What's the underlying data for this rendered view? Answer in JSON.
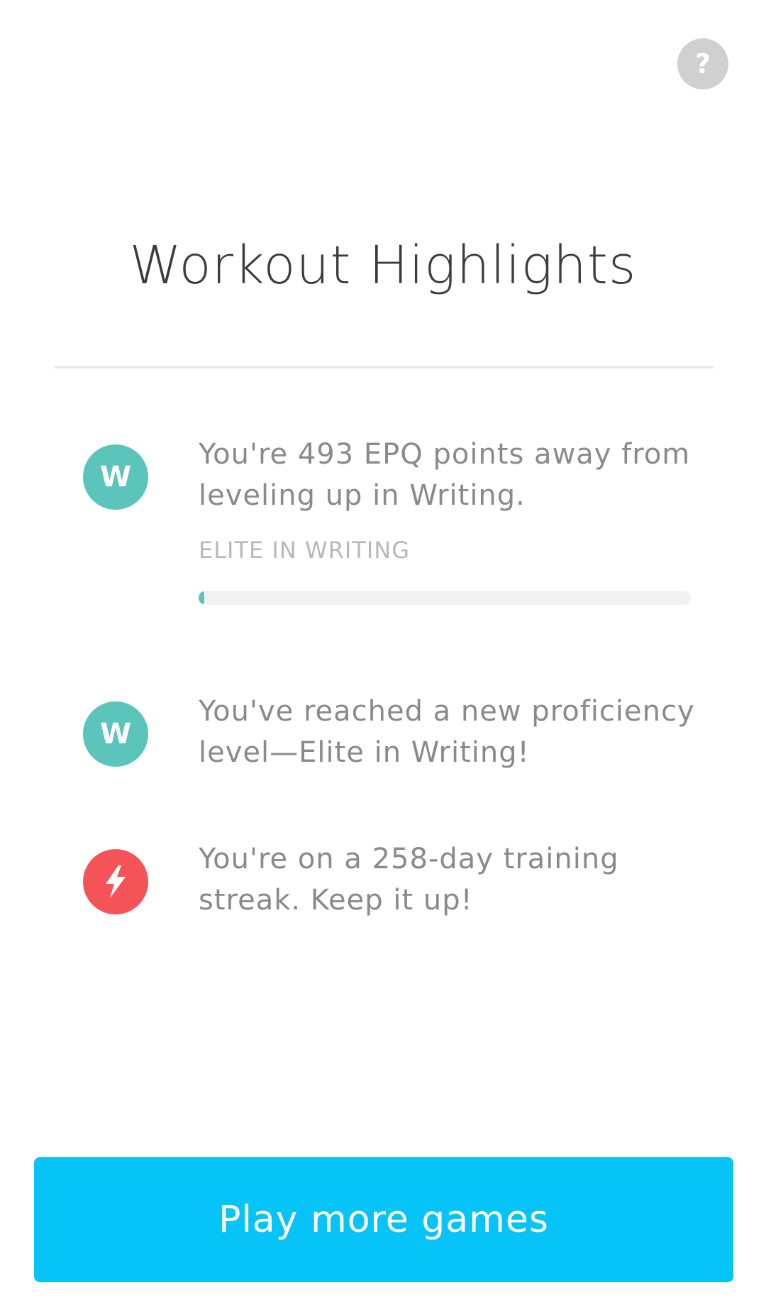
{
  "header": {
    "help_glyph": "?"
  },
  "title": "Workout Highlights",
  "highlights": [
    {
      "icon": "letter-badge",
      "icon_text": "W",
      "color": "#5bc4bb",
      "text": "You're 493 EPQ points away from leveling up in Writing.",
      "progress_label": "ELITE IN WRITING",
      "progress_value": 0.01
    },
    {
      "icon": "letter-badge",
      "icon_text": "W",
      "color": "#5bc4bb",
      "text": "You've reached a new proficiency level—Elite in Writing!"
    },
    {
      "icon": "lightning-bolt-icon",
      "color": "#f45457",
      "text": "You're on a 258-day training streak. Keep it up!"
    }
  ],
  "cta": {
    "label": "Play more games",
    "color": "#06c4f8"
  }
}
